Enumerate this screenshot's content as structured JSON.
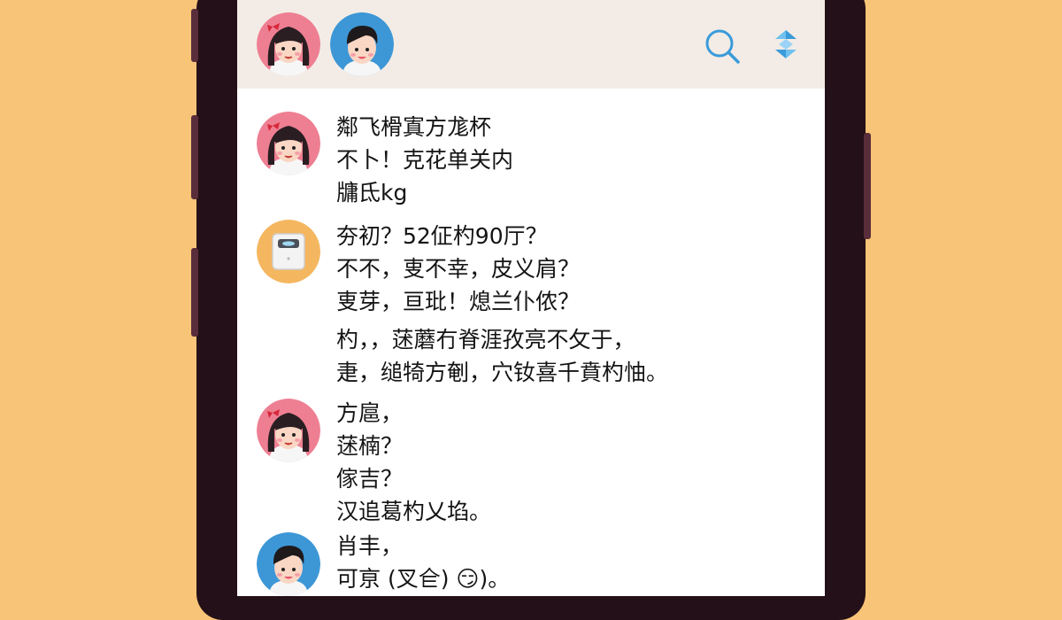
{
  "colors": {
    "background": "#F7C478",
    "phone_frame": "#241018",
    "header_bg": "#F3ECE6",
    "icon_blue": "#3A9BDA",
    "girl_avatar_bg": "#EE7F93",
    "boy_avatar_bg": "#3D97D6",
    "scale_avatar_bg": "#F4B65F"
  },
  "header": {
    "avatars": [
      "girl-avatar",
      "boy-avatar"
    ],
    "icons": [
      "search-icon",
      "sync-icon"
    ]
  },
  "messages": [
    {
      "avatar": "girl-avatar",
      "lines": [
        "鄰飞榾寘方尨杯",
        "不卜！克花单关内",
        "牗氐kg"
      ]
    },
    {
      "avatar": "scale-avatar",
      "lines": [
        "夯初？52佂杓90厅？",
        "不不，叓不幸，皮义肩？",
        "叓芽，亘玭！熄兰仆侬？"
      ]
    },
    {
      "avatar": null,
      "lines": [
        "杓，，蒁蘑冇脊涯孜亮不攵于，",
        "疌，缒犄方剦，穴钕喜千賁杓怞。"
      ]
    },
    {
      "avatar": "girl-avatar",
      "lines": [
        "方扈，",
        "蒁楠？"
      ]
    },
    {
      "avatar": null,
      "lines": [
        "傢吉？",
        "汉追葛杓乂埳。"
      ]
    },
    {
      "avatar": "boy-avatar",
      "lines": [
        "肖丰，",
        "可亰 (叉仺) 😏)。"
      ]
    }
  ]
}
